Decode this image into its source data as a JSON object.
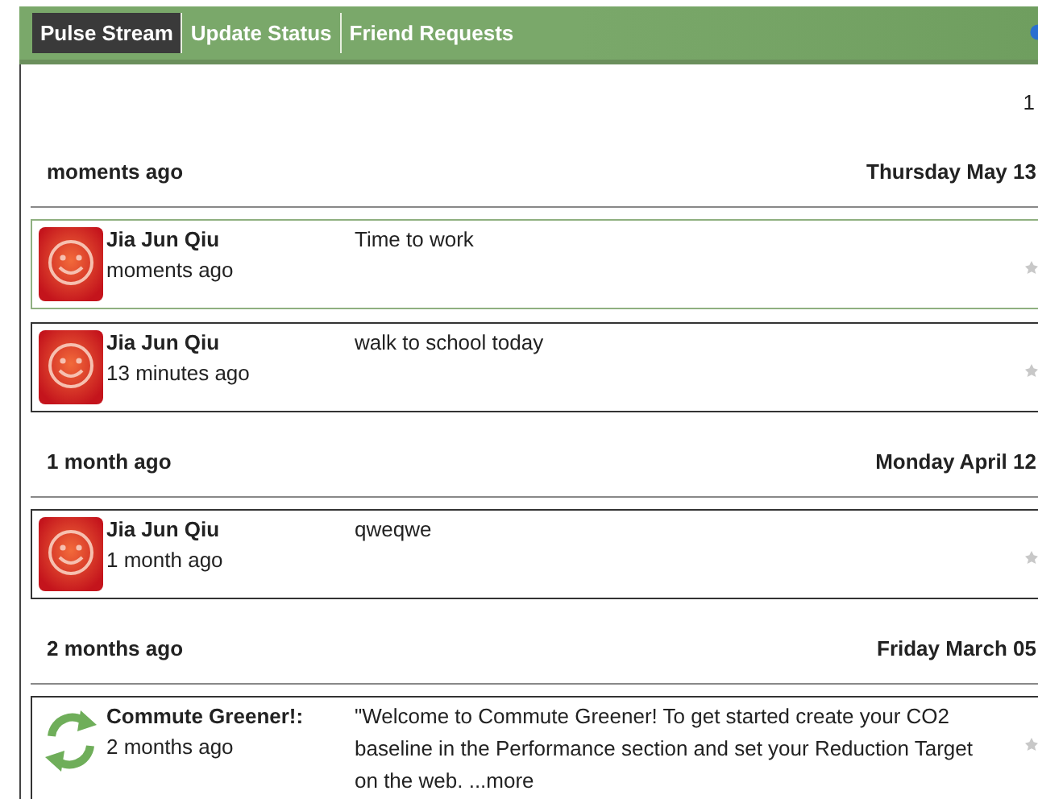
{
  "tabs": [
    {
      "label": "Pulse Stream",
      "selected": true
    },
    {
      "label": "Update Status",
      "selected": false
    },
    {
      "label": "Friend Requests",
      "selected": false
    }
  ],
  "page_indicator": "1",
  "groups": [
    {
      "age": "moments ago",
      "date": "Thursday May 13",
      "entries": [
        {
          "kind": "smiley",
          "name": "Jia Jun Qiu",
          "time": "moments ago",
          "message": "Time to work",
          "selected": true
        },
        {
          "kind": "smiley",
          "name": "Jia Jun Qiu",
          "time": "13 minutes ago",
          "message": "walk to school today",
          "selected": false
        }
      ]
    },
    {
      "age": "1 month ago",
      "date": "Monday April 12",
      "entries": [
        {
          "kind": "smiley",
          "name": "Jia Jun Qiu",
          "time": "1 month ago",
          "message": "qweqwe",
          "selected": false
        }
      ]
    },
    {
      "age": "2 months ago",
      "date": "Friday March 05",
      "entries": [
        {
          "kind": "recycle",
          "name": "Commute Greener!:",
          "time": "2 months ago",
          "message": "\"Welcome to Commute Greener! To get started create your CO2 baseline in the Performance section and set your Reduction Target on the web. ...",
          "more_link": "more",
          "selected": false
        }
      ]
    }
  ]
}
